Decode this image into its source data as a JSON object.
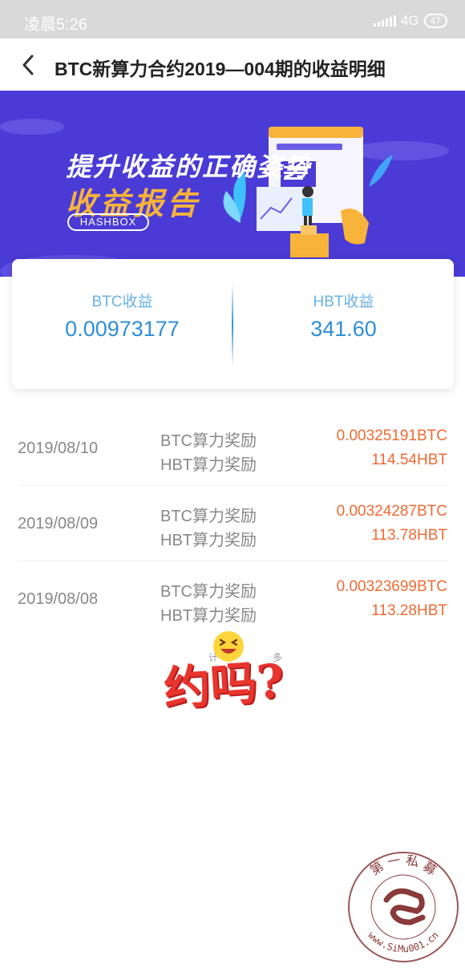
{
  "status_bar": {
    "time": "凌晨5:26",
    "network": "4G",
    "battery": "47"
  },
  "header": {
    "title": "BTC新算力合约2019—004期的收益明细",
    "back_icon": "chevron-left-icon"
  },
  "banner": {
    "line1": "提升收益的正确姿势",
    "line2": "收益报告",
    "badge": "HASHBOX",
    "colors": {
      "background": "#4a3bd6",
      "accent": "#f7b33a"
    }
  },
  "summary": {
    "btc_label": "BTC收益",
    "btc_value": "0.00973177",
    "hbt_label": "HBT收益",
    "hbt_value": "341.60",
    "value_color": "#2e8fd8"
  },
  "records": [
    {
      "date": "2019/08/10",
      "btc_label": "BTC算力奖励",
      "btc_value": "0.00325191BTC",
      "hbt_label": "HBT算力奖励",
      "hbt_value": "114.54HBT"
    },
    {
      "date": "2019/08/09",
      "btc_label": "BTC算力奖励",
      "btc_value": "0.00324287BTC",
      "hbt_label": "HBT算力奖励",
      "hbt_value": "113.78HBT"
    },
    {
      "date": "2019/08/08",
      "btc_label": "BTC算力奖励",
      "btc_value": "0.00323699BTC",
      "hbt_label": "HBT算力奖励",
      "hbt_value": "113.28HBT"
    }
  ],
  "sticker": {
    "text": "约吗?",
    "small_left": "计",
    "small_right": "多",
    "emoji": "grinning-face-icon"
  },
  "watermark": {
    "top_text": "第 一 私 募",
    "bottom_text": "www.SiMu001.cn"
  },
  "value_color": "#f06a33"
}
